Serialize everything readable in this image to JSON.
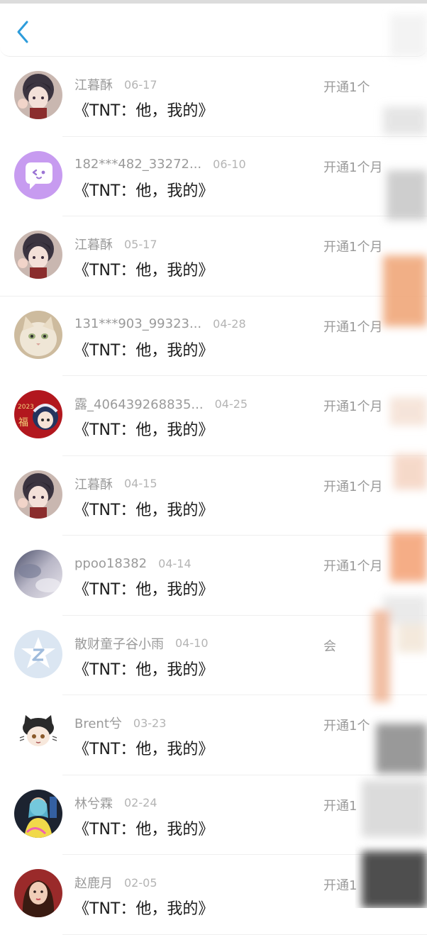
{
  "header": {
    "back_icon": "chevron-left-icon",
    "accent": "#2d9cdb"
  },
  "rows": [
    {
      "name": "江暮酥",
      "date": "06-17",
      "title": "《TNT：他，我的》",
      "action": "开通1个",
      "avatar": "anime-girl-dark-hair"
    },
    {
      "name": "182***482_33272...",
      "date": "06-10",
      "title": "《TNT：他，我的》",
      "action": "开通1个月",
      "avatar": "purple-chat-bubble"
    },
    {
      "name": "江暮酥",
      "date": "05-17",
      "title": "《TNT：他，我的》",
      "action": "开通1个月",
      "avatar": "anime-girl-dark-hair"
    },
    {
      "name": "131***903_99323...",
      "date": "04-28",
      "title": "《TNT：他，我的》",
      "action": "开通1个月",
      "avatar": "cream-cat"
    },
    {
      "name": "露_406439268835...",
      "date": "04-25",
      "title": "《TNT：他，我的》",
      "action": "开通1个月",
      "avatar": "red-new-year-2023"
    },
    {
      "name": "江暮酥",
      "date": "04-15",
      "title": "《TNT：他，我的》",
      "action": "开通1个月",
      "avatar": "anime-girl-dark-hair"
    },
    {
      "name": "ppoo18382",
      "date": "04-14",
      "title": "《TNT：他，我的》",
      "action": "开通1个月",
      "avatar": "blurry-photo"
    },
    {
      "name": "散财童子谷小雨",
      "date": "04-10",
      "title": "《TNT：他，我的》",
      "action": "会",
      "avatar": "default-z-logo"
    },
    {
      "name": "Brent兮",
      "date": "03-23",
      "title": "《TNT：他，我的》",
      "action": "开通1个",
      "avatar": "cartoon-cat-ears"
    },
    {
      "name": "林兮霖",
      "date": "02-24",
      "title": "《TNT：他，我的》",
      "action": "开通1",
      "avatar": "neon-portrait"
    },
    {
      "name": "赵鹿月",
      "date": "02-05",
      "title": "《TNT：他，我的》",
      "action": "开通1",
      "avatar": "girl-portrait"
    }
  ]
}
